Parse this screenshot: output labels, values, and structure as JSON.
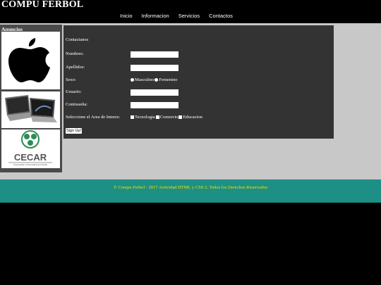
{
  "header": {
    "brand": "COMPU FERBOL",
    "nav": [
      "Inicio",
      "Informacion",
      "Servicios",
      "Contactos"
    ]
  },
  "sidebar": {
    "title": "Anuncios",
    "ads": [
      {
        "name": "apple-logo-ad",
        "alt": "Apple"
      },
      {
        "name": "laptops-ad",
        "alt": "Laptops"
      },
      {
        "name": "cecar-ad",
        "alt": "CECAR",
        "text": "CECAR",
        "subtext": "Corporación Universitaria del Caribe"
      }
    ]
  },
  "form": {
    "heading": "Contactanos",
    "labels": {
      "nombres": "Nombres:",
      "apellidos": "Apellidos:",
      "sexo": "Sexo:",
      "usuario": "Usuario:",
      "contrasena": "Contraseña:",
      "area": "Seleccione el Area de Interes:"
    },
    "sexo_options": [
      "Masculino",
      "Femenino"
    ],
    "area_options": [
      "Tecnologia",
      "Comercio",
      "Educacion"
    ],
    "submit": "Sign Up!"
  },
  "footer": {
    "text": "© Compu Ferbol - 2017 Actividad HTML y CSS 2. Todos los Derechos Reservados"
  }
}
